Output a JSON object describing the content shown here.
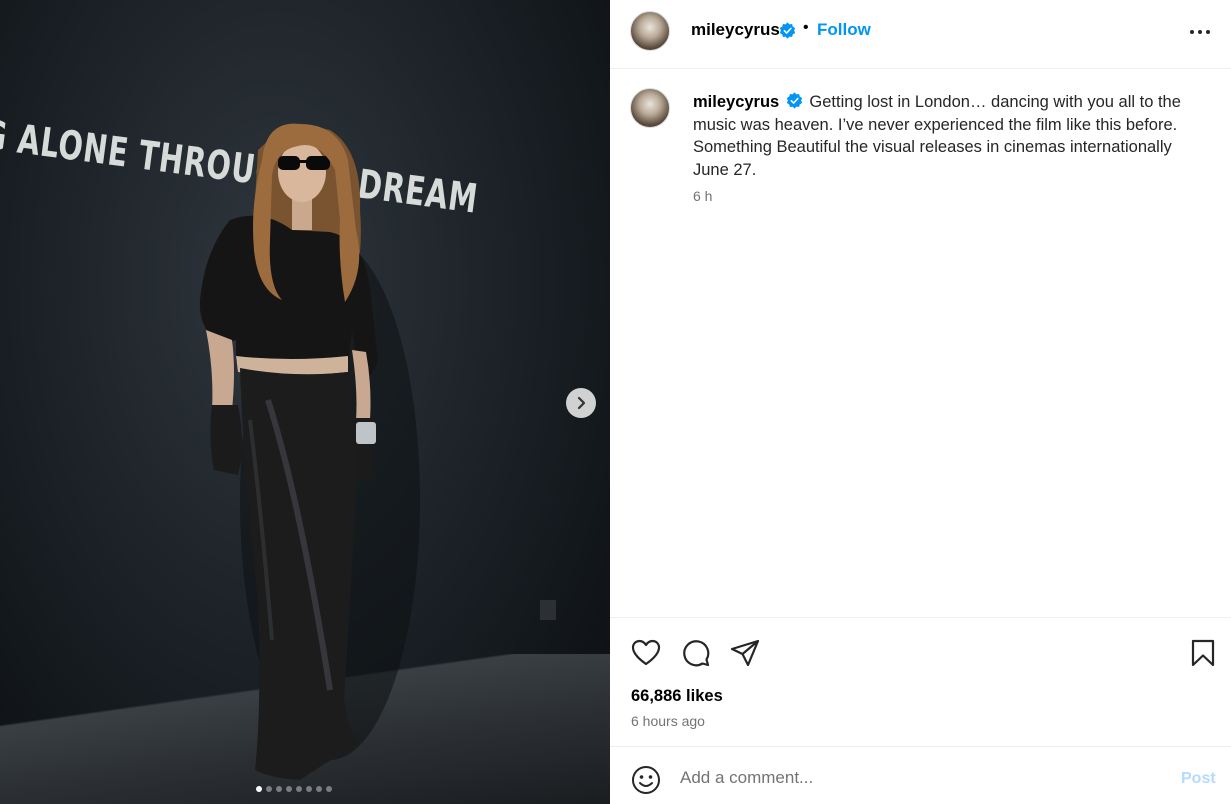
{
  "post": {
    "username": "mileycyrus",
    "verified": true,
    "separator": "•",
    "follow_label": "Follow",
    "more_icon": "more-options-icon"
  },
  "caption": {
    "username": "mileycyrus",
    "text": "Getting lost in London… dancing with you all to the music was heaven. I’ve never experienced the film like this before. Something Beautiful the visual releases in cinemas internationally June 27.",
    "time": "6 h"
  },
  "media": {
    "wall_text": "G ALONE THROUG     CID DREAM",
    "next_icon": "chevron-right-icon",
    "slide_count": 8,
    "current_slide": 1
  },
  "actions": {
    "like_icon": "heart-icon",
    "comment_icon": "comment-icon",
    "share_icon": "send-icon",
    "save_icon": "bookmark-icon"
  },
  "stats": {
    "likes": "66,886 likes",
    "posted_ago": "6 hours ago"
  },
  "comment": {
    "placeholder": "Add a comment...",
    "post_label": "Post",
    "emoji_icon": "emoji-icon"
  },
  "colors": {
    "link_blue": "#0095f6",
    "post_disabled": "#b3dbff",
    "secondary_text": "#737373",
    "verified_blue": "#0095f6"
  }
}
